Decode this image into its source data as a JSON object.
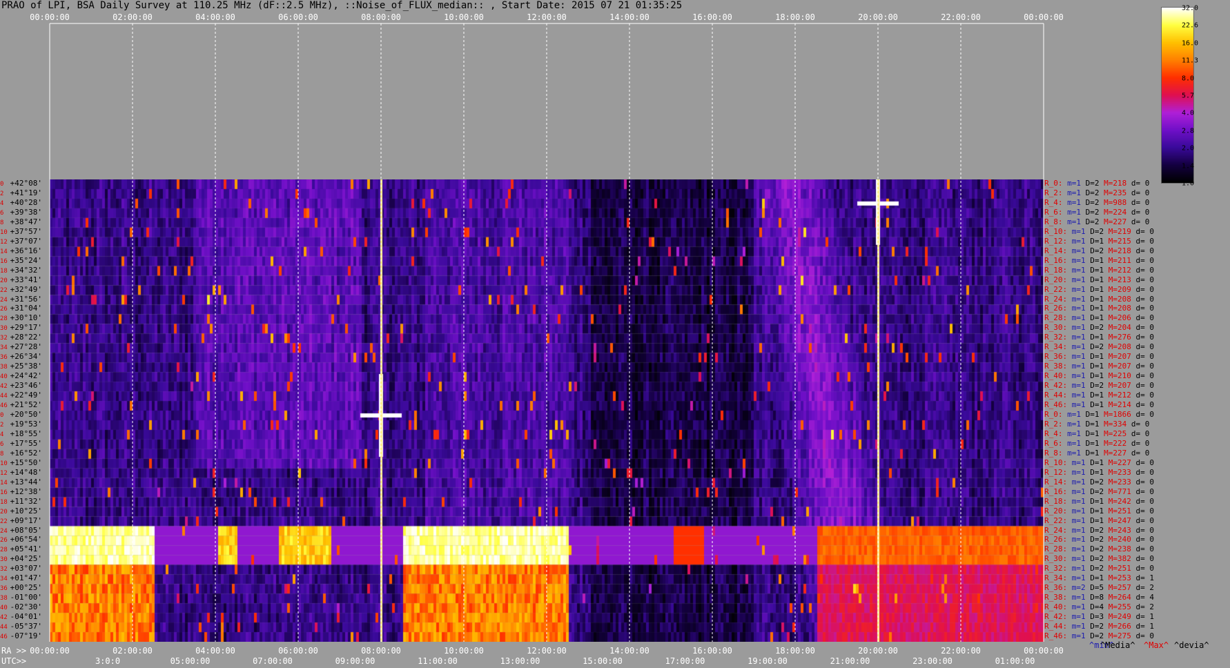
{
  "title": "PRAO of LPI, BSA Daily Survey at 110.25 MHz (dF::2.5 MHz), ::Noise_of_FLUX_median:: , Start Date: 2015 07 21 01:35:25",
  "top_ticks": [
    "00:00:00",
    "02:00:00",
    "04:00:00",
    "06:00:00",
    "08:00:00",
    "10:00:00",
    "12:00:00",
    "14:00:00",
    "16:00:00",
    "18:00:00",
    "20:00:00",
    "22:00:00",
    "00:00:00"
  ],
  "bottom": {
    "ra_prefix": "RA >>",
    "utc_prefix": "UTC>>",
    "ra_ticks": [
      "00:00:00",
      "02:00:00",
      "04:00:00",
      "06:00:00",
      "08:00:00",
      "10:00:00",
      "12:00:00",
      "14:00:00",
      "16:00:00",
      "18:00:00",
      "20:00:00",
      "22:00:00",
      "00:00:00"
    ],
    "utc_ticks": [
      "3:0:0",
      "05:00:00",
      "07:00:00",
      "09:00:00",
      "11:00:00",
      "13:00:00",
      "15:00:00",
      "17:00:00",
      "19:00:00",
      "21:00:00",
      "23:00:00",
      "01:00:00"
    ]
  },
  "legend": {
    "min": "^min^",
    "media": "^Media^",
    "max": "^Max^",
    "devia": "^devia^"
  },
  "colorbar_labels": [
    "32.0",
    "22.6",
    "16.0",
    "11.3",
    "8.0",
    "5.7",
    "4.0",
    "2.8",
    "2.0",
    "1.4",
    "1.0"
  ],
  "declinations": [
    {
      "i": "0",
      "d": "+42°08'"
    },
    {
      "i": "2",
      "d": "+41°19'"
    },
    {
      "i": "4",
      "d": "+40°28'"
    },
    {
      "i": "6",
      "d": "+39°38'"
    },
    {
      "i": "8",
      "d": "+38°47'"
    },
    {
      "i": "10",
      "d": "+37°57'"
    },
    {
      "i": "12",
      "d": "+37°07'"
    },
    {
      "i": "14",
      "d": "+36°16'"
    },
    {
      "i": "16",
      "d": "+35°24'"
    },
    {
      "i": "18",
      "d": "+34°32'"
    },
    {
      "i": "20",
      "d": "+33°41'"
    },
    {
      "i": "22",
      "d": "+32°49'"
    },
    {
      "i": "24",
      "d": "+31°56'"
    },
    {
      "i": "26",
      "d": "+31°04'"
    },
    {
      "i": "28",
      "d": "+30°10'"
    },
    {
      "i": "30",
      "d": "+29°17'"
    },
    {
      "i": "32",
      "d": "+28°22'"
    },
    {
      "i": "34",
      "d": "+27°28'"
    },
    {
      "i": "36",
      "d": "+26°34'"
    },
    {
      "i": "38",
      "d": "+25°38'"
    },
    {
      "i": "40",
      "d": "+24°42'"
    },
    {
      "i": "42",
      "d": "+23°46'"
    },
    {
      "i": "44",
      "d": "+22°49'"
    },
    {
      "i": "46",
      "d": "+21°52'"
    },
    {
      "i": "0",
      "d": "+20°50'"
    },
    {
      "i": "2",
      "d": "+19°53'"
    },
    {
      "i": "4",
      "d": "+18°55'"
    },
    {
      "i": "6",
      "d": "+17°55'"
    },
    {
      "i": "8",
      "d": "+16°52'"
    },
    {
      "i": "10",
      "d": "+15°50'"
    },
    {
      "i": "12",
      "d": "+14°48'"
    },
    {
      "i": "14",
      "d": "+13°44'"
    },
    {
      "i": "16",
      "d": "+12°38'"
    },
    {
      "i": "18",
      "d": "+11°32'"
    },
    {
      "i": "20",
      "d": "+10°25'"
    },
    {
      "i": "22",
      "d": "+09°17'"
    },
    {
      "i": "24",
      "d": "+08°05'"
    },
    {
      "i": "26",
      "d": "+06°54'"
    },
    {
      "i": "28",
      "d": "+05°41'"
    },
    {
      "i": "30",
      "d": "+04°25'"
    },
    {
      "i": "32",
      "d": "+03°07'"
    },
    {
      "i": "34",
      "d": "+01°47'"
    },
    {
      "i": "36",
      "d": "+00°25'"
    },
    {
      "i": "38",
      "d": "-01°00'"
    },
    {
      "i": "40",
      "d": "-02°30'"
    },
    {
      "i": "42",
      "d": "-04°01'"
    },
    {
      "i": "44",
      "d": "-05°37'"
    },
    {
      "i": "46",
      "d": "-07°19'"
    }
  ],
  "stats": [
    {
      "r": "R_0:",
      "m": "m=1",
      "d": "D=2",
      "M": "M=218",
      "dd": "d= 0"
    },
    {
      "r": "R_2:",
      "m": "m=1",
      "d": "D=2",
      "M": "M=235",
      "dd": "d= 0"
    },
    {
      "r": "R_4:",
      "m": "m=1",
      "d": "D=2",
      "M": "M=988",
      "dd": "d= 0"
    },
    {
      "r": "R_6:",
      "m": "m=1",
      "d": "D=2",
      "M": "M=224",
      "dd": "d= 0"
    },
    {
      "r": "R_8:",
      "m": "m=1",
      "d": "D=2",
      "M": "M=227",
      "dd": "d= 0"
    },
    {
      "r": "R_10:",
      "m": "m=1",
      "d": "D=2",
      "M": "M=219",
      "dd": "d= 0"
    },
    {
      "r": "R_12:",
      "m": "m=1",
      "d": "D=1",
      "M": "M=215",
      "dd": "d= 0"
    },
    {
      "r": "R_14:",
      "m": "m=1",
      "d": "D=2",
      "M": "M=218",
      "dd": "d= 0"
    },
    {
      "r": "R_16:",
      "m": "m=1",
      "d": "D=1",
      "M": "M=211",
      "dd": "d= 0"
    },
    {
      "r": "R_18:",
      "m": "m=1",
      "d": "D=1",
      "M": "M=212",
      "dd": "d= 0"
    },
    {
      "r": "R_20:",
      "m": "m=1",
      "d": "D=1",
      "M": "M=213",
      "dd": "d= 0"
    },
    {
      "r": "R_22:",
      "m": "m=1",
      "d": "D=1",
      "M": "M=209",
      "dd": "d= 0"
    },
    {
      "r": "R_24:",
      "m": "m=1",
      "d": "D=1",
      "M": "M=208",
      "dd": "d= 0"
    },
    {
      "r": "R_26:",
      "m": "m=1",
      "d": "D=1",
      "M": "M=208",
      "dd": "d= 0"
    },
    {
      "r": "R_28:",
      "m": "m=1",
      "d": "D=1",
      "M": "M=206",
      "dd": "d= 0"
    },
    {
      "r": "R_30:",
      "m": "m=1",
      "d": "D=2",
      "M": "M=204",
      "dd": "d= 0"
    },
    {
      "r": "R_32:",
      "m": "m=1",
      "d": "D=1",
      "M": "M=276",
      "dd": "d= 0"
    },
    {
      "r": "R_34:",
      "m": "m=1",
      "d": "D=2",
      "M": "M=208",
      "dd": "d= 0"
    },
    {
      "r": "R_36:",
      "m": "m=1",
      "d": "D=1",
      "M": "M=207",
      "dd": "d= 0"
    },
    {
      "r": "R_38:",
      "m": "m=1",
      "d": "D=1",
      "M": "M=207",
      "dd": "d= 0"
    },
    {
      "r": "R_40:",
      "m": "m=1",
      "d": "D=1",
      "M": "M=210",
      "dd": "d= 0"
    },
    {
      "r": "R_42:",
      "m": "m=1",
      "d": "D=2",
      "M": "M=207",
      "dd": "d= 0"
    },
    {
      "r": "R_44:",
      "m": "m=1",
      "d": "D=1",
      "M": "M=212",
      "dd": "d= 0"
    },
    {
      "r": "R_46:",
      "m": "m=1",
      "d": "D=1",
      "M": "M=214",
      "dd": "d= 0"
    },
    {
      "r": "R_0:",
      "m": "m=1",
      "d": "D=1",
      "M": "M=1866",
      "dd": "d= 0"
    },
    {
      "r": "R_2:",
      "m": "m=1",
      "d": "D=1",
      "M": "M=334",
      "dd": "d= 0"
    },
    {
      "r": "R_4:",
      "m": "m=1",
      "d": "D=1",
      "M": "M=225",
      "dd": "d= 0"
    },
    {
      "r": "R_6:",
      "m": "m=1",
      "d": "D=1",
      "M": "M=222",
      "dd": "d= 0"
    },
    {
      "r": "R_8:",
      "m": "m=1",
      "d": "D=1",
      "M": "M=227",
      "dd": "d= 0"
    },
    {
      "r": "R_10:",
      "m": "m=1",
      "d": "D=1",
      "M": "M=227",
      "dd": "d= 0"
    },
    {
      "r": "R_12:",
      "m": "m=1",
      "d": "D=1",
      "M": "M=233",
      "dd": "d= 0"
    },
    {
      "r": "R_14:",
      "m": "m=1",
      "d": "D=2",
      "M": "M=233",
      "dd": "d= 0"
    },
    {
      "r": "R_16:",
      "m": "m=1",
      "d": "D=2",
      "M": "M=771",
      "dd": "d= 0"
    },
    {
      "r": "R_18:",
      "m": "m=1",
      "d": "D=1",
      "M": "M=242",
      "dd": "d= 0"
    },
    {
      "r": "R_20:",
      "m": "m=1",
      "d": "D=1",
      "M": "M=251",
      "dd": "d= 0"
    },
    {
      "r": "R_22:",
      "m": "m=1",
      "d": "D=1",
      "M": "M=247",
      "dd": "d= 0"
    },
    {
      "r": "R_24:",
      "m": "m=1",
      "d": "D=2",
      "M": "M=243",
      "dd": "d= 0"
    },
    {
      "r": "R_26:",
      "m": "m=1",
      "d": "D=2",
      "M": "M=240",
      "dd": "d= 0"
    },
    {
      "r": "R_28:",
      "m": "m=1",
      "d": "D=2",
      "M": "M=238",
      "dd": "d= 0"
    },
    {
      "r": "R_30:",
      "m": "m=1",
      "d": "D=2",
      "M": "M=382",
      "dd": "d= 0"
    },
    {
      "r": "R_32:",
      "m": "m=1",
      "d": "D=2",
      "M": "M=251",
      "dd": "d= 0"
    },
    {
      "r": "R_34:",
      "m": "m=1",
      "d": "D=1",
      "M": "M=253",
      "dd": "d= 1"
    },
    {
      "r": "R_36:",
      "m": "m=2",
      "d": "D=5",
      "M": "M=257",
      "dd": "d= 2"
    },
    {
      "r": "R_38:",
      "m": "m=1",
      "d": "D=8",
      "M": "M=264",
      "dd": "d= 4"
    },
    {
      "r": "R_40:",
      "m": "m=1",
      "d": "D=4",
      "M": "M=255",
      "dd": "d= 2"
    },
    {
      "r": "R_42:",
      "m": "m=1",
      "d": "D=3",
      "M": "M=249",
      "dd": "d= 1"
    },
    {
      "r": "R_44:",
      "m": "m=1",
      "d": "D=2",
      "M": "M=266",
      "dd": "d= 1"
    },
    {
      "r": "R_46:",
      "m": "m=1",
      "d": "D=2",
      "M": "M=275",
      "dd": "d= 0"
    }
  ],
  "chart_data": {
    "type": "heatmap",
    "title": "PRAO of LPI, BSA Daily Survey at 110.25 MHz (dF::2.5 MHz), ::Noise_of_FLUX_median:: , Start Date: 2015 07 21 01:35:25",
    "x_axis_top": "RA",
    "x_ticks": [
      "00:00:00",
      "02:00:00",
      "04:00:00",
      "06:00:00",
      "08:00:00",
      "10:00:00",
      "12:00:00",
      "14:00:00",
      "16:00:00",
      "18:00:00",
      "20:00:00",
      "22:00:00",
      "00:00:00"
    ],
    "y_axis": "declination",
    "color_scale": [
      1.0,
      32.0
    ],
    "colormap": [
      "#000000",
      "#140040",
      "#3a0a9a",
      "#7010c8",
      "#b020d8",
      "#e01050",
      "#ff3000",
      "#ff8000",
      "#ffc000",
      "#ffff40",
      "#ffffff"
    ],
    "bright_sources": [
      {
        "ra_hours": 8.0,
        "row": 24,
        "level": 32.0
      },
      {
        "ra_hours": 20.0,
        "row": 2,
        "level": 32.0
      }
    ],
    "bright_band_rows": [
      36,
      37,
      38,
      39
    ]
  }
}
